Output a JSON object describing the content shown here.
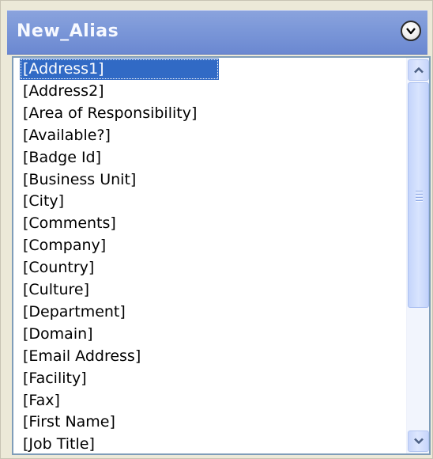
{
  "panel": {
    "title": "New_Alias",
    "collapse_icon": "chevron-down-circle-icon"
  },
  "list": {
    "selected_index": 0,
    "items": [
      "[Address1]",
      "[Address2]",
      "[Area of Responsibility]",
      "[Available?]",
      "[Badge Id]",
      "[Business Unit]",
      "[City]",
      "[Comments]",
      "[Company]",
      "[Country]",
      "[Culture]",
      "[Department]",
      "[Domain]",
      "[Email Address]",
      "[Facility]",
      "[Fax]",
      "[First Name]",
      "[Job Title]"
    ]
  },
  "scrollbar": {
    "up_icon": "chevron-up-icon",
    "down_icon": "chevron-down-icon",
    "grip_icon": "grip-lines-icon"
  },
  "colors": {
    "header": "#7b97d8",
    "selection": "#316ac5",
    "border": "#7f9db9"
  }
}
